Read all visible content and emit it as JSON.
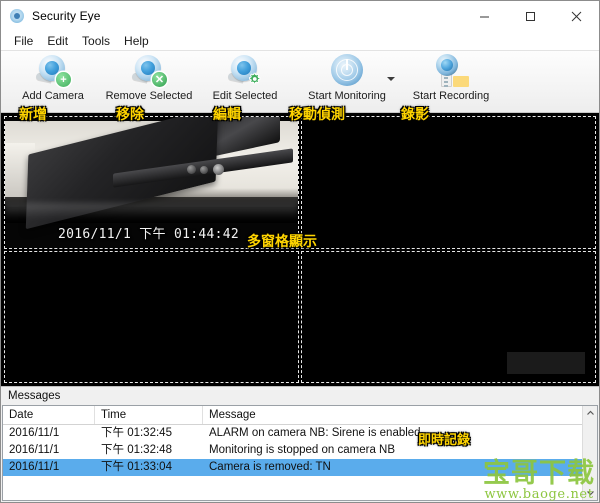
{
  "window": {
    "title": "Security Eye",
    "app_icon": "camera-dome-icon",
    "controls": {
      "minimize": "minimize-icon",
      "maximize": "maximize-icon",
      "close": "close-icon"
    }
  },
  "menu": {
    "items": [
      {
        "label": "File"
      },
      {
        "label": "Edit"
      },
      {
        "label": "Tools"
      },
      {
        "label": "Help"
      }
    ]
  },
  "toolbar": {
    "buttons": [
      {
        "label": "Add Camera",
        "icon": "camera-add-icon"
      },
      {
        "label": "Remove Selected",
        "icon": "camera-remove-icon"
      },
      {
        "label": "Edit Selected",
        "icon": "camera-edit-icon"
      },
      {
        "label": "Start Monitoring",
        "icon": "radar-monitor-icon",
        "has_dropdown": true
      },
      {
        "label": "Start Recording",
        "icon": "recorder-icon"
      }
    ]
  },
  "annotations": {
    "add": "新增",
    "remove": "移除",
    "edit": "編輯",
    "monitor": "移動偵測",
    "record": "錄影",
    "multipane": "多窗格顯示",
    "log": "即時記錄",
    "color": "#ffd400"
  },
  "video": {
    "panes": [
      {
        "name": "camera-1",
        "timestamp": "2016/11/1 下午 01:44:42",
        "has_feed": true
      },
      {
        "name": "camera-2",
        "has_feed": false
      },
      {
        "name": "camera-3",
        "has_feed": false
      },
      {
        "name": "camera-4",
        "has_feed": false
      }
    ]
  },
  "messages": {
    "title": "Messages",
    "columns": [
      "Date",
      "Time",
      "Message"
    ],
    "rows": [
      {
        "date": "2016/11/1",
        "time": "下午 01:32:45",
        "message": "ALARM on camera NB: Sirene is enabled",
        "selected": false
      },
      {
        "date": "2016/11/1",
        "time": "下午 01:32:48",
        "message": "Monitoring is stopped on camera NB",
        "selected": false
      },
      {
        "date": "2016/11/1",
        "time": "下午 01:33:04",
        "message": "Camera is removed: TN",
        "selected": true
      }
    ],
    "scrollbar": {
      "up": "chevron-up-icon",
      "down": "chevron-down-icon"
    }
  },
  "watermark": {
    "text": "宝哥下载",
    "url": "www.baoge.net",
    "color": "#8dc63f"
  }
}
